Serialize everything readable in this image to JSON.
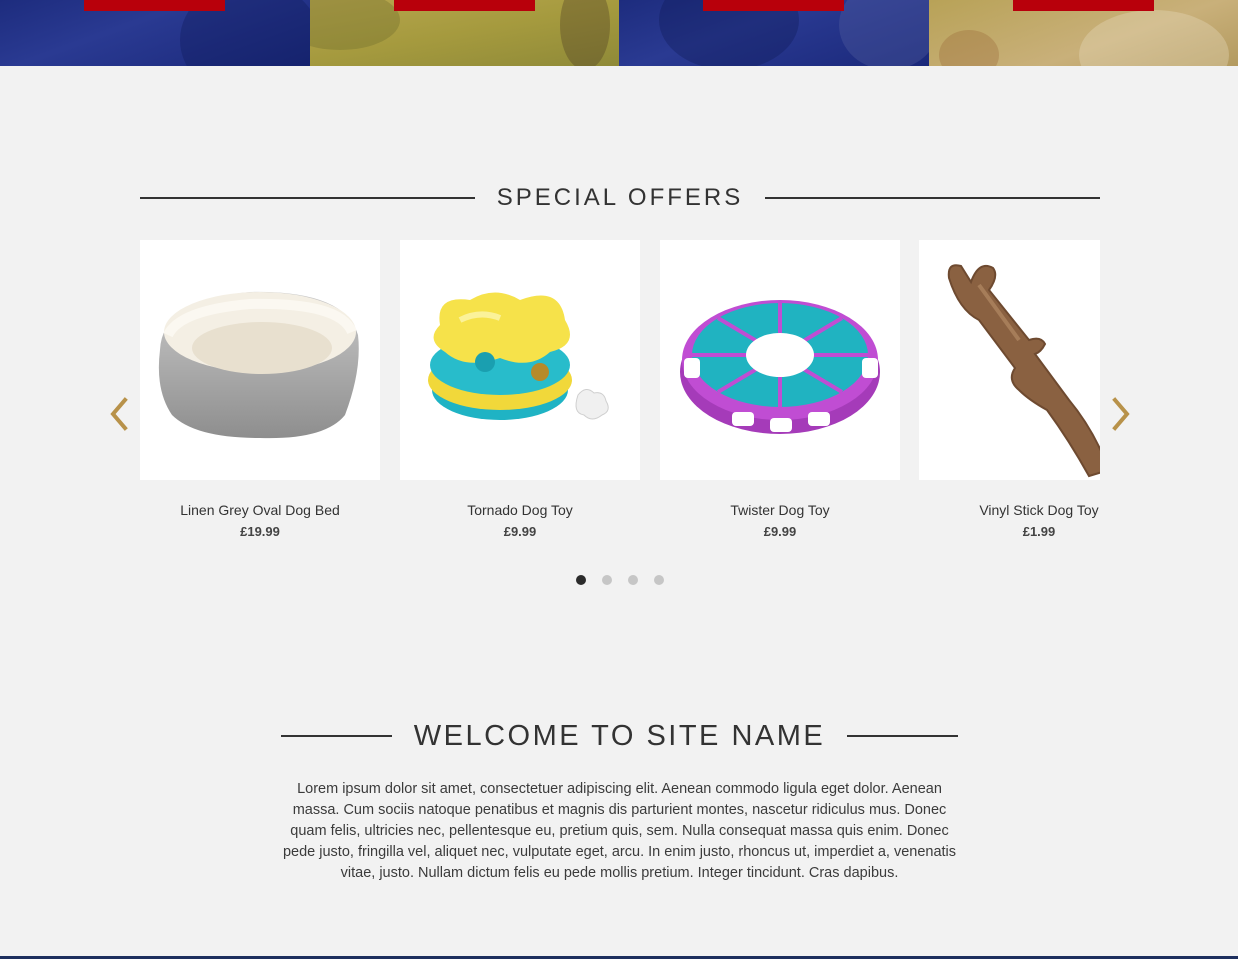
{
  "banner": {
    "tiles": [
      {
        "tone": "blue"
      },
      {
        "tone": "gold"
      },
      {
        "tone": "blue"
      },
      {
        "tone": "gold"
      }
    ]
  },
  "offers": {
    "title": "SPECIAL OFFERS",
    "products": [
      {
        "name": "Linen Grey Oval Dog Bed",
        "price": "£19.99",
        "image": "dog-bed"
      },
      {
        "name": "Tornado Dog Toy",
        "price": "£9.99",
        "image": "puzzle-toy"
      },
      {
        "name": "Twister Dog Toy",
        "price": "£9.99",
        "image": "twister-toy"
      },
      {
        "name": "Vinyl Stick Dog Toy",
        "price": "£1.99",
        "image": "stick-toy"
      }
    ],
    "prev_icon": "chevron-left-icon",
    "next_icon": "chevron-right-icon",
    "arrow_color": "#b8924a",
    "pagination": {
      "pages": 4,
      "active": 1
    }
  },
  "welcome": {
    "title": "WELCOME TO SITE NAME",
    "body": "Lorem ipsum dolor sit amet, consectetuer adipiscing elit. Aenean commodo ligula eget dolor. Aenean massa. Cum sociis natoque penatibus et magnis dis parturient montes, nascetur ridiculus mus. Donec quam felis, ultricies nec, pellentesque eu, pretium quis, sem. Nulla consequat massa quis enim. Donec pede justo, fringilla vel, aliquet nec, vulputate eget, arcu. In enim justo, rhoncus ut, imperdiet a, venenatis vitae, justo. Nullam dictum felis eu pede mollis pretium. Integer tincidunt. Cras dapibus."
  },
  "colors": {
    "accent": "#b8000b",
    "navy": "#1e2f5e",
    "background": "#f2f2f2"
  }
}
